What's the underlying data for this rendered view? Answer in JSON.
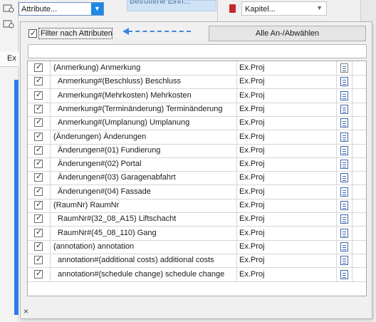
{
  "toolbar": {
    "attribute_combo_value": "Attribute...",
    "attribute_combo_arrow": "▼",
    "listbox_fragment": "Betroffene Einh...",
    "kapitel_combo_value": "Kapitel...",
    "kapitel_combo_arrow": "▼"
  },
  "left_panel": {
    "tab_label": "Ex"
  },
  "popup": {
    "filter_label": "Filter nach Attributen",
    "filter_checked": true,
    "toggle_all_label": "Alle An-/Abwählen",
    "search_value": "",
    "close_label": "×"
  },
  "grid": {
    "rows": [
      {
        "checked": true,
        "name": "(Anmerkung) Anmerkung",
        "proj": "Ex.Proj",
        "level": 0
      },
      {
        "checked": true,
        "name": "Anmerkung#(Beschluss) Beschluss",
        "proj": "Ex.Proj",
        "level": 1
      },
      {
        "checked": true,
        "name": "Anmerkung#(Mehrkosten) Mehrkosten",
        "proj": "Ex.Proj",
        "level": 1
      },
      {
        "checked": true,
        "name": "Anmerkung#(Terminänderung) Terminänderung",
        "proj": "Ex.Proj",
        "level": 1
      },
      {
        "checked": true,
        "name": "Anmerkung#(Umplanung) Umplanung",
        "proj": "Ex.Proj",
        "level": 1
      },
      {
        "checked": true,
        "name": "(Änderungen) Änderungen",
        "proj": "Ex.Proj",
        "level": 0
      },
      {
        "checked": true,
        "name": "Änderungen#(01) Fundierung",
        "proj": "Ex.Proj",
        "level": 1
      },
      {
        "checked": true,
        "name": "Änderungen#(02) Portal",
        "proj": "Ex.Proj",
        "level": 1
      },
      {
        "checked": true,
        "name": "Änderungen#(03) Garagenabfahrt",
        "proj": "Ex.Proj",
        "level": 1
      },
      {
        "checked": true,
        "name": "Änderungen#(04) Fassade",
        "proj": "Ex.Proj",
        "level": 1
      },
      {
        "checked": true,
        "name": "(RaumNr) RaumNr",
        "proj": "Ex.Proj",
        "level": 0
      },
      {
        "checked": true,
        "name": "RaumNr#(32_08_A15) Liftschacht",
        "proj": "Ex.Proj",
        "level": 1
      },
      {
        "checked": true,
        "name": "RaumNr#(45_08_110) Gang",
        "proj": "Ex.Proj",
        "level": 1
      },
      {
        "checked": true,
        "name": "(annotation) annotation",
        "proj": "Ex.Proj",
        "level": 0
      },
      {
        "checked": true,
        "name": "annotation#(additional costs) additional costs",
        "proj": "Ex.Proj",
        "level": 1
      },
      {
        "checked": true,
        "name": "annotation#(schedule change) schedule change",
        "proj": "Ex.Proj",
        "level": 1
      }
    ],
    "checkmark": "✓"
  },
  "colors": {
    "accent": "#1e88e5",
    "annotation_arrow": "#3d86e0",
    "kapitel_icon": "#c62828"
  }
}
